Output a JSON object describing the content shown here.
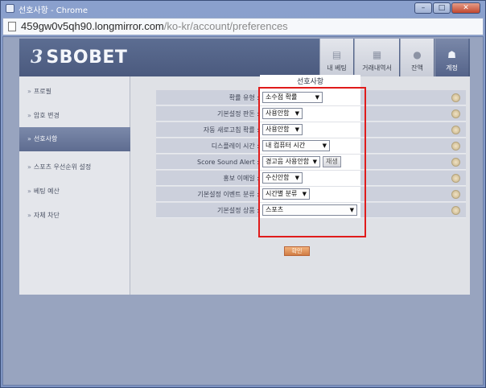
{
  "window": {
    "title": "선호사항 - Chrome",
    "url_host": "459gw0v5qh90.longmirror.com",
    "url_path": "/ko-kr/account/preferences",
    "controls": [
      "–",
      "□",
      "✕"
    ]
  },
  "header": {
    "brand": "SBOBET",
    "tabs": [
      {
        "label": "내 베팅",
        "icon": "document-icon",
        "glyph": "▤"
      },
      {
        "label": "거래내역서",
        "icon": "ledger-icon",
        "glyph": "▦"
      },
      {
        "label": "잔액",
        "icon": "coin-icon",
        "glyph": "●"
      },
      {
        "label": "계정",
        "icon": "user-icon",
        "glyph": "☗"
      }
    ]
  },
  "sidebar": {
    "items": [
      {
        "label": "프로필"
      },
      {
        "label": "암호 변경"
      },
      {
        "label": "선호사항"
      },
      {
        "label": "스포츠 우선순위 설정"
      },
      {
        "label": "베팅 예산"
      },
      {
        "label": "자체 차단"
      }
    ]
  },
  "prefs": {
    "heading": "선호사항",
    "rows": [
      {
        "label": "확률 유형 :",
        "value": "소수점 확률"
      },
      {
        "label": "기본설정 판돈 :",
        "value": "사용안함"
      },
      {
        "label": "자동 새로고침 확률 :",
        "value": "사용안함"
      },
      {
        "label": "디스플레이 시간 :",
        "value": "내 컴퓨터 시간"
      },
      {
        "label": "Score Sound Alert :",
        "value": "경고음 사용안함",
        "button": "재생"
      },
      {
        "label": "홍보 이메일 :",
        "value": "수신안함"
      },
      {
        "label": "기본설정 이벤트 분류 :",
        "value": "시간별 분류"
      },
      {
        "label": "기본설정 상품 :",
        "value": "스포츠"
      }
    ],
    "confirm": "확인"
  },
  "colors": {
    "highlight_box": "#e01b1b",
    "header_bg": "#4b5a7e",
    "active_tab": "#55648a"
  }
}
